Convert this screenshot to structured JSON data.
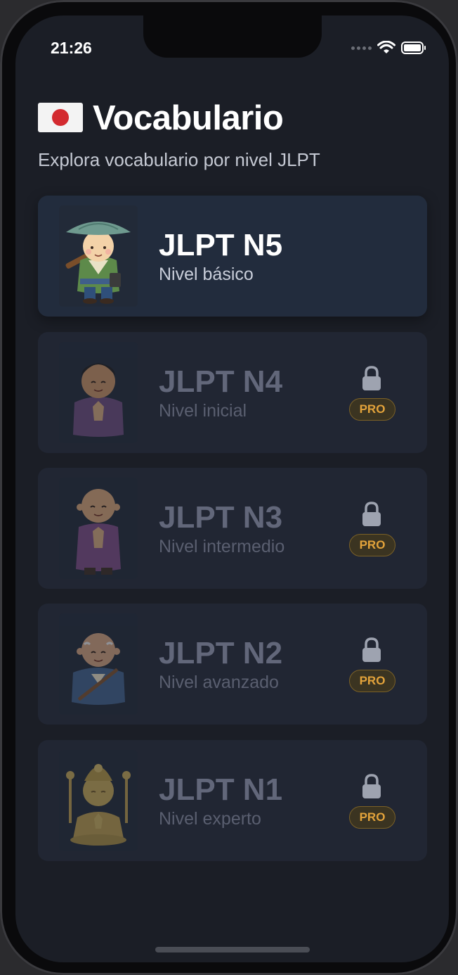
{
  "status_bar": {
    "time": "21:26"
  },
  "header": {
    "title": "Vocabulario",
    "subtitle": "Explora vocabulario por nivel JLPT",
    "flag_icon": "japan-flag-icon"
  },
  "levels": [
    {
      "title": "JLPT N5",
      "subtitle": "Nivel básico",
      "locked": false
    },
    {
      "title": "JLPT N4",
      "subtitle": "Nivel inicial",
      "locked": true,
      "badge": "PRO"
    },
    {
      "title": "JLPT N3",
      "subtitle": "Nivel intermedio",
      "locked": true,
      "badge": "PRO"
    },
    {
      "title": "JLPT N2",
      "subtitle": "Nivel avanzado",
      "locked": true,
      "badge": "PRO"
    },
    {
      "title": "JLPT N1",
      "subtitle": "Nivel experto",
      "locked": true,
      "badge": "PRO"
    }
  ],
  "colors": {
    "background": "#1b1e26",
    "card": "#212633",
    "card_active": "#222c3d",
    "pro_text": "#e3a33b",
    "flag_red": "#d32a2f"
  }
}
